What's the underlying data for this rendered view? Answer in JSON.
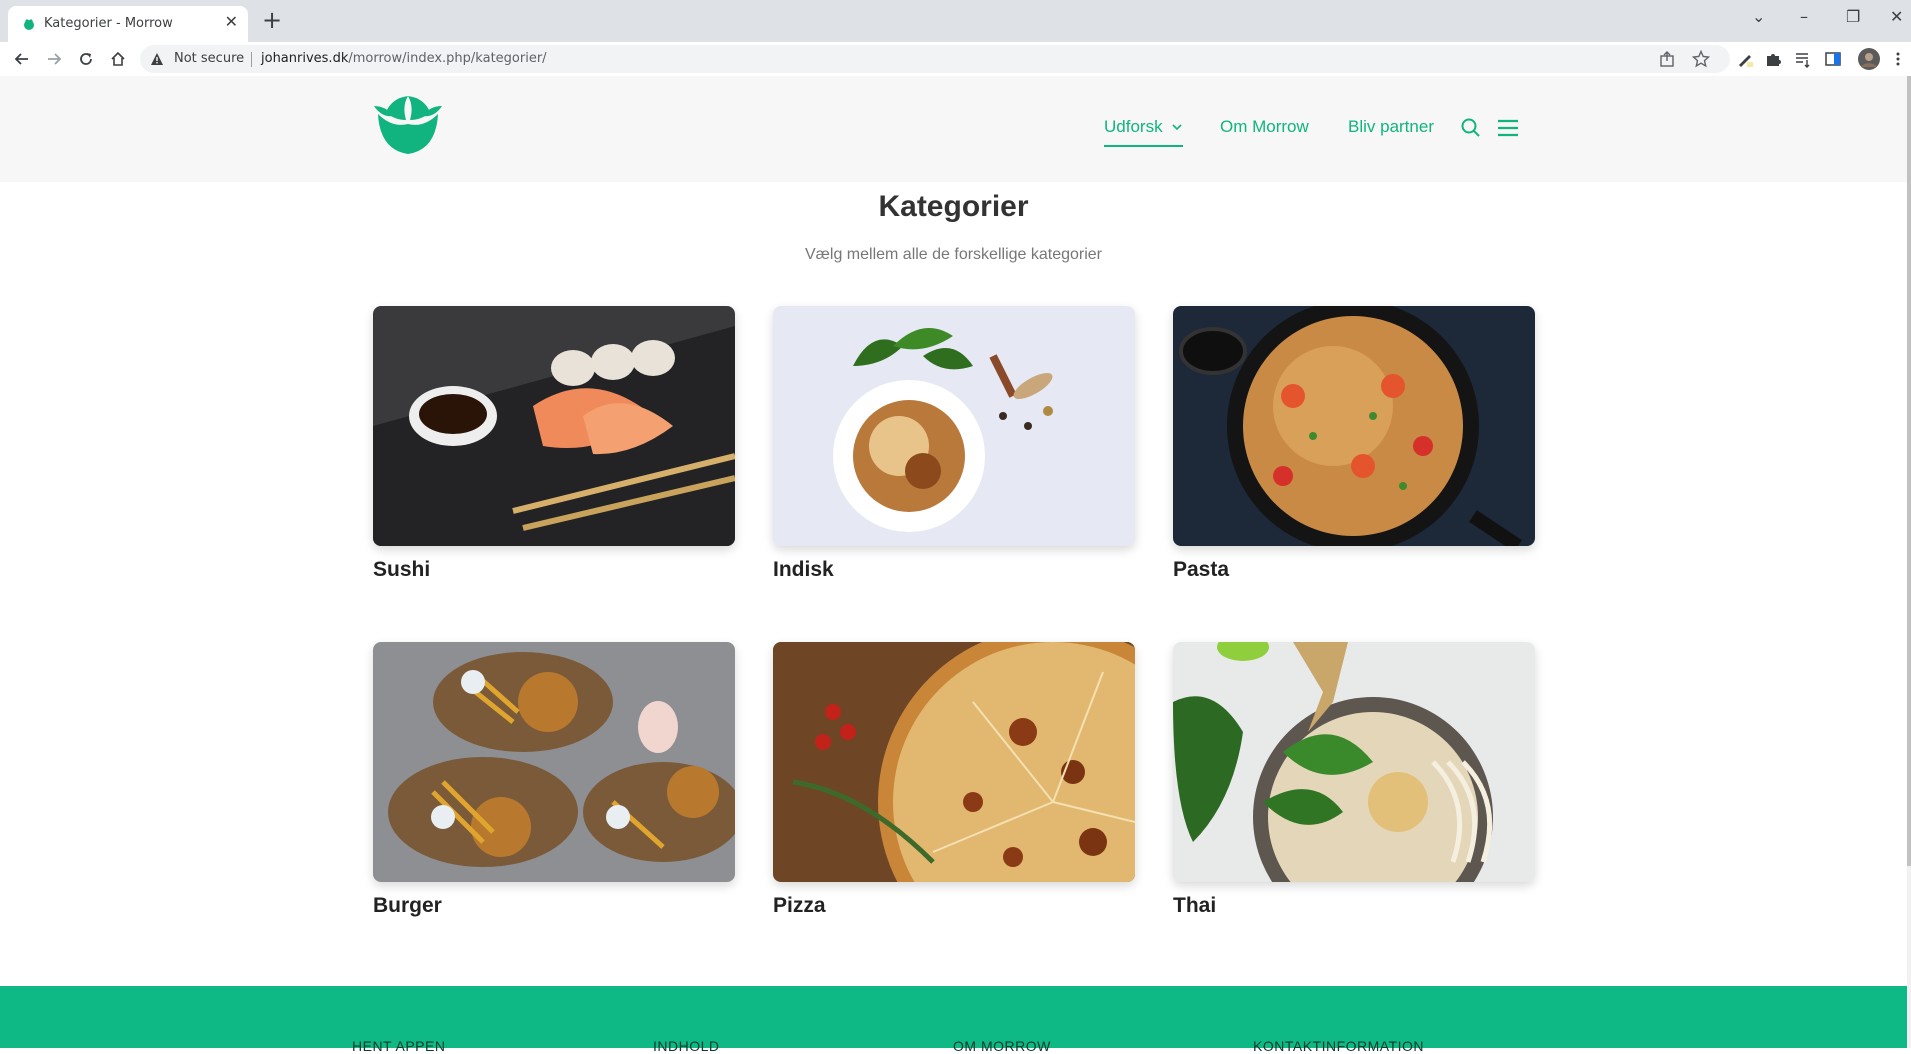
{
  "browser": {
    "tab_title": "Kategorier - Morrow",
    "tab_close": "✕",
    "new_tab": "+",
    "security_label": "Not secure",
    "url_host": "johanrives.dk",
    "url_path": "/morrow/index.php/kategorier/",
    "window_controls": {
      "chevron": "⌄",
      "minimize": "–",
      "restore": "❐",
      "close": "✕"
    }
  },
  "header": {
    "nav": [
      {
        "label": "Udforsk"
      },
      {
        "label": "Om Morrow"
      },
      {
        "label": "Bliv partner"
      }
    ],
    "accent": "#11b47f"
  },
  "main": {
    "title": "Kategorier",
    "subtitle": "Vælg mellem alle de forskellige kategorier",
    "categories": [
      {
        "label": "Sushi"
      },
      {
        "label": "Indisk"
      },
      {
        "label": "Pasta"
      },
      {
        "label": "Burger"
      },
      {
        "label": "Pizza"
      },
      {
        "label": "Thai"
      }
    ]
  },
  "footer": {
    "color": "#0fb985",
    "columns": [
      {
        "heading": "HENT APPEN"
      },
      {
        "heading": "INDHOLD"
      },
      {
        "heading": "OM MORROW"
      },
      {
        "heading": "KONTAKTINFORMATION"
      }
    ]
  }
}
